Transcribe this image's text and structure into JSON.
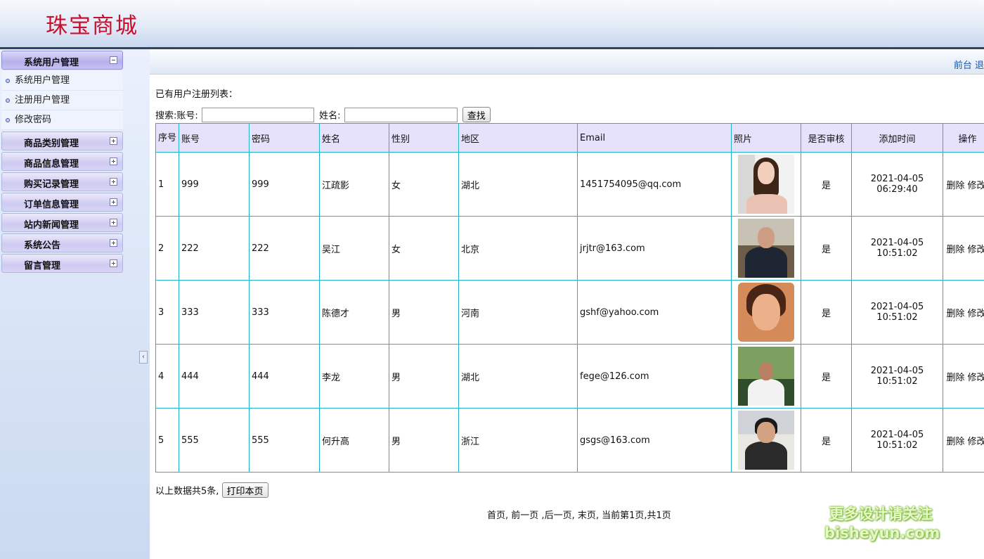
{
  "header": {
    "brand": "珠宝商城"
  },
  "top_nav": {
    "front": "前台",
    "logout": "退"
  },
  "sidebar": {
    "groups": [
      {
        "label": "系统用户管理",
        "open": true,
        "items": [
          "系统用户管理",
          "注册用户管理",
          "修改密码"
        ]
      },
      {
        "label": "商品类别管理",
        "open": false
      },
      {
        "label": "商品信息管理",
        "open": false
      },
      {
        "label": "购买记录管理",
        "open": false
      },
      {
        "label": "订单信息管理",
        "open": false
      },
      {
        "label": "站内新闻管理",
        "open": false
      },
      {
        "label": "系统公告",
        "open": false
      },
      {
        "label": "留言管理",
        "open": false
      }
    ]
  },
  "page": {
    "list_title": "已有用户注册列表：",
    "search": {
      "label_prefix": "搜索:",
      "account_label": "账号:",
      "account_value": "",
      "name_label": "姓名:",
      "name_value": "",
      "button": "查找"
    },
    "table": {
      "headers": {
        "seq": "序号",
        "account": "账号",
        "password": "密码",
        "name": "姓名",
        "gender": "性别",
        "region": "地区",
        "email": "Email",
        "photo": "照片",
        "approved": "是否审核",
        "added_time": "添加时间",
        "actions": "操作"
      },
      "rows": [
        {
          "seq": "1",
          "account": "999",
          "password": "999",
          "name": "江疏影",
          "gender": "女",
          "region": "湖北",
          "email": "1451754095@qq.com",
          "approved": "是",
          "date": "2021-04-05",
          "time": "06:29:40"
        },
        {
          "seq": "2",
          "account": "222",
          "password": "222",
          "name": "吴江",
          "gender": "女",
          "region": "北京",
          "email": "jrjtr@163.com",
          "approved": "是",
          "date": "2021-04-05",
          "time": "10:51:02"
        },
        {
          "seq": "3",
          "account": "333",
          "password": "333",
          "name": "陈德才",
          "gender": "男",
          "region": "河南",
          "email": "gshf@yahoo.com",
          "approved": "是",
          "date": "2021-04-05",
          "time": "10:51:02"
        },
        {
          "seq": "4",
          "account": "444",
          "password": "444",
          "name": "李龙",
          "gender": "男",
          "region": "湖北",
          "email": "fege@126.com",
          "approved": "是",
          "date": "2021-04-05",
          "time": "10:51:02"
        },
        {
          "seq": "5",
          "account": "555",
          "password": "555",
          "name": "何升高",
          "gender": "男",
          "region": "浙江",
          "email": "gsgs@163.com",
          "approved": "是",
          "date": "2021-04-05",
          "time": "10:51:02"
        }
      ],
      "action_delete": "删除",
      "action_edit": "修改"
    },
    "summary": {
      "text": "以上数据共5条,",
      "print_button": "打印本页"
    },
    "pager": {
      "first": "首页",
      "sep1": ", ",
      "prev": "前一页",
      "sep2": " ,",
      "next": "后一页",
      "sep3": ", ",
      "last": "末页",
      "sep4": ", ",
      "status": "当前第1页,共1页"
    }
  },
  "watermark": {
    "line1": "更多设计请关注",
    "line2": "bisheyun.com"
  }
}
